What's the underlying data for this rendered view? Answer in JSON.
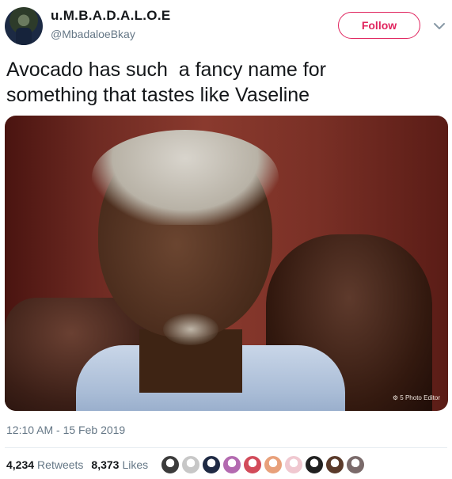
{
  "author": {
    "display_name": "u.M.B.A.D.A.L.O.E",
    "handle": "@MbadaloeBkay"
  },
  "follow_button": {
    "label": "Follow",
    "accent": "#e0245e"
  },
  "tweet": {
    "text": "Avocado has such  a fancy name for\nsomething that tastes like Vaseline",
    "photo_watermark": "⚙ 5 Photo Editor",
    "timestamp": "12:10 AM - 15 Feb 2019"
  },
  "stats": {
    "retweets_count": "4,234",
    "retweets_label": "Retweets",
    "likes_count": "8,373",
    "likes_label": "Likes"
  },
  "likers": [
    {
      "icon": "avatar-icon",
      "color": "#3b3b3b"
    },
    {
      "icon": "avatar-icon",
      "color": "#c7c7c7"
    },
    {
      "icon": "avatar-icon",
      "color": "#1f2a44"
    },
    {
      "icon": "avatar-icon",
      "color": "#b36ab0"
    },
    {
      "icon": "avatar-icon",
      "color": "#d24b5a"
    },
    {
      "icon": "avatar-icon",
      "color": "#e8a07a"
    },
    {
      "icon": "avatar-icon",
      "color": "#f0c8d0"
    },
    {
      "icon": "avatar-icon",
      "color": "#202020"
    },
    {
      "icon": "avatar-icon",
      "color": "#5a3a2a"
    },
    {
      "icon": "avatar-icon",
      "color": "#7a6a6a"
    }
  ]
}
